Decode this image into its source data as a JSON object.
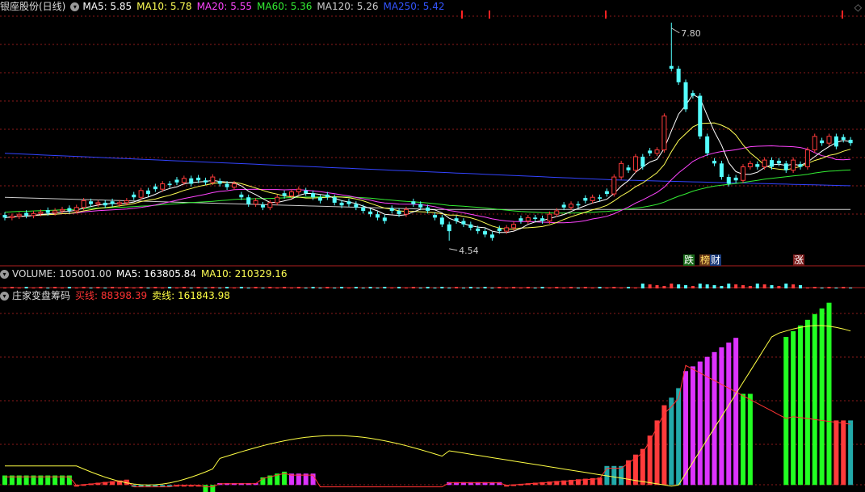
{
  "main_header": {
    "title": "银座股份(日线)",
    "ma5": "MA5: 5.85",
    "ma10": "MA10: 5.78",
    "ma20": "MA20: 5.55",
    "ma60": "MA60: 5.36",
    "ma120": "MA120: 5.26",
    "ma250": "MA250: 5.42"
  },
  "volume_header": {
    "volume": "VOLUME: 105001.00",
    "ma5": "MA5: 163805.84",
    "ma10": "MA10: 210329.16"
  },
  "chip_header": {
    "title": "庄家变盘筹码",
    "buy": "买线: 88398.39",
    "sell": "卖线: 161843.98"
  },
  "annotations": {
    "high": "7.80",
    "low": "4.54"
  },
  "event_tags": {
    "die": "跌",
    "bang": "榜",
    "cai": "财",
    "zhang": "涨"
  },
  "colors": {
    "up": "#ff3b3b",
    "down": "#54ffff",
    "ma5": "#ffffff",
    "ma10": "#ffff55",
    "ma20": "#ff44ff",
    "ma60": "#33ee33",
    "ma120": "#cccccc",
    "ma250": "#3344ff",
    "buy_line": "#ff3333",
    "sell_line": "#ffff44",
    "grid": "#8b1a1a"
  },
  "chart_data": {
    "type": "candlestick",
    "ylim": [
      4.3,
      8.0
    ],
    "high": 7.8,
    "low": 4.54,
    "candle_count": 119,
    "closes": [
      5.0,
      5.02,
      5.04,
      5.03,
      5.06,
      5.08,
      5.07,
      5.1,
      5.12,
      5.1,
      5.15,
      5.25,
      5.2,
      5.22,
      5.18,
      5.2,
      5.22,
      5.25,
      5.3,
      5.4,
      5.35,
      5.42,
      5.5,
      5.48,
      5.52,
      5.58,
      5.5,
      5.55,
      5.52,
      5.6,
      5.5,
      5.45,
      5.5,
      5.3,
      5.2,
      5.25,
      5.15,
      5.22,
      5.3,
      5.32,
      5.38,
      5.42,
      5.36,
      5.3,
      5.25,
      5.3,
      5.22,
      5.18,
      5.2,
      5.15,
      5.1,
      5.05,
      5.0,
      4.95,
      5.1,
      5.05,
      5.12,
      5.2,
      5.15,
      5.1,
      5.0,
      4.9,
      4.8,
      4.95,
      4.9,
      4.85,
      4.8,
      4.75,
      4.7,
      4.8,
      4.85,
      4.9,
      4.95,
      5.0,
      4.98,
      4.95,
      5.05,
      5.1,
      5.15,
      5.2,
      5.18,
      5.25,
      5.3,
      5.28,
      5.35,
      5.6,
      5.8,
      5.7,
      5.9,
      5.75,
      5.95,
      6.0,
      6.5,
      7.2,
      7.0,
      6.6,
      6.8,
      6.2,
      5.95,
      5.8,
      5.6,
      5.5,
      5.55,
      5.75,
      5.8,
      5.75,
      5.85,
      5.75,
      5.8,
      5.7,
      5.85,
      5.75,
      6.0,
      6.2,
      6.1,
      6.2,
      6.05,
      6.15,
      6.1
    ]
  }
}
